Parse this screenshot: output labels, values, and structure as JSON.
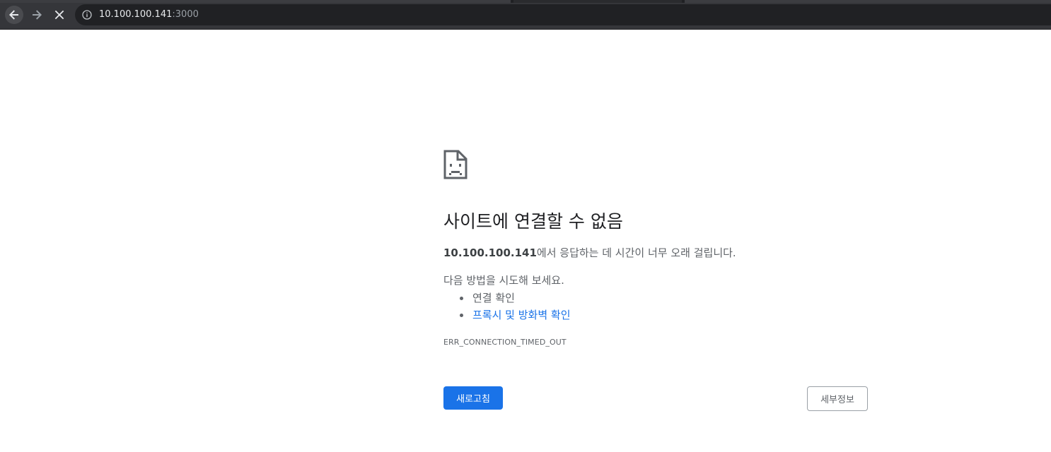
{
  "browser": {
    "url_host": "10.100.100.141",
    "url_port": ":3000",
    "icons": {
      "back": "arrow-left-icon",
      "forward": "arrow-right-icon",
      "stop": "close-icon",
      "site_info": "info-icon"
    }
  },
  "error_page": {
    "icon": "sad-page-icon",
    "heading": "사이트에 연결할 수 없음",
    "summary_host": "10.100.100.141",
    "summary_text": "에서 응답하는 데 시간이 너무 오래 걸립니다.",
    "suggestions_intro": "다음 방법을 시도해 보세요.",
    "suggestions": [
      {
        "label": "연결 확인"
      },
      {
        "label": "프록시 및 방화벽 확인"
      }
    ],
    "error_code": "ERR_CONNECTION_TIMED_OUT",
    "reload_label": "새로고침",
    "details_label": "세부정보"
  },
  "colors": {
    "toolbar": "#35363a",
    "omnibox": "#202124",
    "link": "#1a73e8",
    "primary_button": "#1a73e8",
    "text": "#5f6368",
    "heading": "#202124"
  }
}
